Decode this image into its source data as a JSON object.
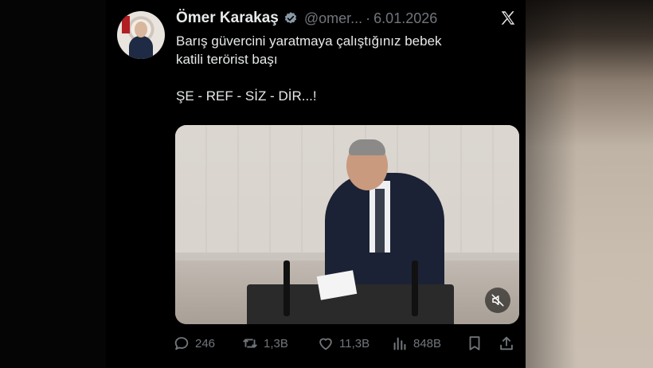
{
  "tweet": {
    "author_name": "Ömer Karakaş",
    "handle": "@omer...",
    "separator": "·",
    "date": "6.01.2026",
    "text_line1": "Barış güvercini yaratmaya çalıştığınız bebek",
    "text_line2": "katili terörist başı",
    "text_line3": "ŞE - REF - SİZ - DİR...!",
    "verified": true
  },
  "actions": {
    "replies": "246",
    "reposts": "1,3B",
    "likes": "11,3B",
    "views": "848B"
  },
  "icons": {
    "reply": "comment-icon",
    "repost": "repost-icon",
    "like": "heart-icon",
    "views": "views-icon",
    "bookmark": "bookmark-icon",
    "share": "share-icon",
    "x": "x-logo-icon",
    "verified": "verified-badge-icon",
    "mute": "mute-icon"
  },
  "colors": {
    "background": "#000000",
    "text": "#e7e9ea",
    "muted": "#71767b",
    "verified": "#8899a6"
  }
}
